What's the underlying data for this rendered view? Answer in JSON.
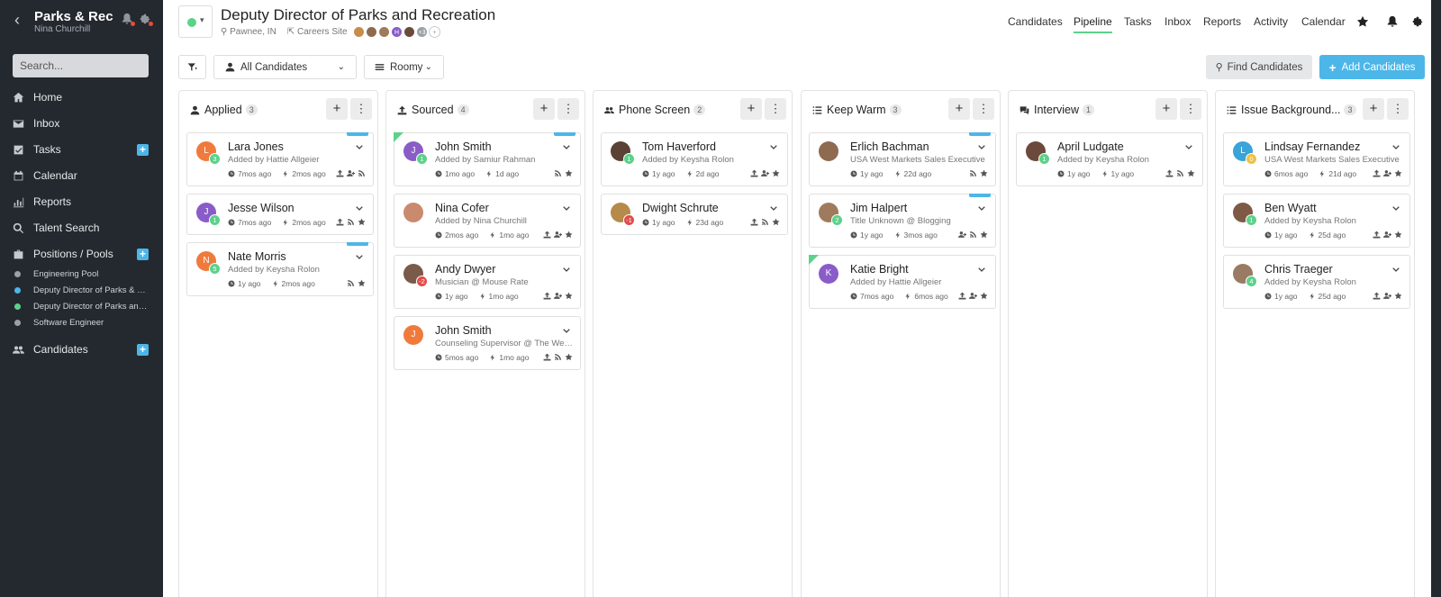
{
  "sidebar": {
    "org": "Parks & Rec",
    "user": "Nina Churchill",
    "search_placeholder": "Search...",
    "nav": [
      {
        "label": "Home",
        "icon": "home-icon"
      },
      {
        "label": "Inbox",
        "icon": "envelope-icon"
      },
      {
        "label": "Tasks",
        "icon": "checkbox-icon",
        "plus": "+"
      },
      {
        "label": "Calendar",
        "icon": "calendar-icon"
      },
      {
        "label": "Reports",
        "icon": "bar-chart-icon"
      },
      {
        "label": "Talent Search",
        "icon": "search-icon"
      },
      {
        "label": "Positions / Pools",
        "icon": "briefcase-icon",
        "plus": "+"
      }
    ],
    "pools": [
      {
        "label": "Engineering Pool",
        "color": "#9aa0a6"
      },
      {
        "label": "Deputy Director of Parks & Recreation",
        "color": "#4db6e8"
      },
      {
        "label": "Deputy Director of Parks and Recreation",
        "color": "#5bd28a"
      },
      {
        "label": "Software Engineer",
        "color": "#9aa0a6"
      }
    ],
    "candidates": {
      "label": "Candidates",
      "plus": "+"
    }
  },
  "header": {
    "title": "Deputy Director of Parks and Recreation",
    "location": "Pawnee, IN",
    "careers": "Careers Site",
    "extra_count": "+3",
    "status_color": "#5bd28a",
    "tabs": [
      "Candidates",
      "Pipeline",
      "Tasks",
      "Inbox",
      "Reports",
      "Activity",
      "Calendar"
    ],
    "active_tab": "Pipeline"
  },
  "toolbar": {
    "filter_select": "All Candidates",
    "view_select": "Roomy",
    "find_label": "Find Candidates",
    "add_label": "Add Candidates"
  },
  "columns": [
    {
      "title": "Applied",
      "count": "3",
      "icon": "user-icon",
      "cards": [
        {
          "name": "Lara Jones",
          "sub": "Added by Hattie Allgeier",
          "t1": "7mos ago",
          "t2": "2mos ago",
          "initial": "L",
          "avatar_color": "#f07a3c",
          "badge": "3",
          "badge_color": "#5bd28a",
          "ribbon": true,
          "corner": false
        },
        {
          "name": "Jesse Wilson",
          "sub": "",
          "t1": "7mos ago",
          "t2": "2mos ago",
          "initial": "J",
          "avatar_color": "#8a5cc8",
          "badge": "1",
          "badge_color": "#5bd28a",
          "ribbon": false,
          "corner": false
        },
        {
          "name": "Nate Morris",
          "sub": "Added by Keysha Rolon",
          "t1": "1y ago",
          "t2": "2mos ago",
          "initial": "N",
          "avatar_color": "#f07a3c",
          "badge": "5",
          "badge_color": "#5bd28a",
          "ribbon": true,
          "corner": false
        }
      ]
    },
    {
      "title": "Sourced",
      "count": "4",
      "icon": "upload-icon",
      "cards": [
        {
          "name": "John Smith",
          "sub": "Added by Samiur Rahman",
          "t1": "1mo ago",
          "t2": "1d ago",
          "initial": "J",
          "avatar_color": "#8a5cc8",
          "badge": "1",
          "badge_color": "#5bd28a",
          "ribbon": true,
          "corner": true
        },
        {
          "name": "Nina Cofer",
          "sub": "Added by Nina Churchill",
          "t1": "2mos ago",
          "t2": "1mo ago",
          "initial": "",
          "avatar_color": "#c98a6e",
          "badge": "",
          "badge_color": "",
          "ribbon": false,
          "corner": false
        },
        {
          "name": "Andy Dwyer",
          "sub": "Musician @ Mouse Rate",
          "t1": "1y ago",
          "t2": "1mo ago",
          "initial": "",
          "avatar_color": "#7a5a48",
          "badge": "-2",
          "badge_color": "#e24b4b",
          "ribbon": false,
          "corner": false
        },
        {
          "name": "John Smith",
          "sub": "Counseling Supervisor @ The Wellness Center",
          "t1": "5mos ago",
          "t2": "1mo ago",
          "initial": "J",
          "avatar_color": "#f07a3c",
          "badge": "",
          "badge_color": "",
          "ribbon": false,
          "corner": false
        }
      ]
    },
    {
      "title": "Phone Screen",
      "count": "2",
      "icon": "users-icon",
      "cards": [
        {
          "name": "Tom Haverford",
          "sub": "Added by Keysha Rolon",
          "t1": "1y ago",
          "t2": "2d ago",
          "initial": "",
          "avatar_color": "#5b4236",
          "badge": "1",
          "badge_color": "#5bd28a",
          "ribbon": false,
          "corner": false
        },
        {
          "name": "Dwight Schrute",
          "sub": "",
          "t1": "1y ago",
          "t2": "23d ago",
          "initial": "",
          "avatar_color": "#b58a4a",
          "badge": "-1",
          "badge_color": "#e24b4b",
          "ribbon": false,
          "corner": false
        }
      ]
    },
    {
      "title": "Keep Warm",
      "count": "3",
      "icon": "list-icon",
      "cards": [
        {
          "name": "Erlich Bachman",
          "sub": "USA West Markets Sales Executive",
          "t1": "1y ago",
          "t2": "22d ago",
          "initial": "",
          "avatar_color": "#8e6a4f",
          "badge": "",
          "badge_color": "",
          "ribbon": true,
          "corner": false
        },
        {
          "name": "Jim Halpert",
          "sub": "Title Unknown @ Blogging",
          "t1": "1y ago",
          "t2": "3mos ago",
          "initial": "",
          "avatar_color": "#a07a5c",
          "badge": "2",
          "badge_color": "#5bd28a",
          "ribbon": true,
          "corner": false
        },
        {
          "name": "Katie Bright",
          "sub": "Added by Hattie Allgeier",
          "t1": "7mos ago",
          "t2": "6mos ago",
          "initial": "K",
          "avatar_color": "#8a5cc8",
          "badge": "",
          "badge_color": "",
          "ribbon": false,
          "corner": true
        }
      ]
    },
    {
      "title": "Interview",
      "count": "1",
      "icon": "comments-icon",
      "cards": [
        {
          "name": "April Ludgate",
          "sub": "Added by Keysha Rolon",
          "t1": "1y ago",
          "t2": "1y ago",
          "initial": "",
          "avatar_color": "#6b4a3c",
          "badge": "1",
          "badge_color": "#5bd28a",
          "ribbon": false,
          "corner": false
        }
      ]
    },
    {
      "title": "Issue Background...",
      "count": "3",
      "icon": "list-icon",
      "cards": [
        {
          "name": "Lindsay Fernandez",
          "sub": "USA West Markets Sales Executive",
          "t1": "6mos ago",
          "t2": "21d ago",
          "initial": "L",
          "avatar_color": "#3aa3d8",
          "badge": "0",
          "badge_color": "#f0c040",
          "ribbon": false,
          "corner": false
        },
        {
          "name": "Ben Wyatt",
          "sub": "Added by Keysha Rolon",
          "t1": "1y ago",
          "t2": "25d ago",
          "initial": "",
          "avatar_color": "#7e5a44",
          "badge": "1",
          "badge_color": "#5bd28a",
          "ribbon": false,
          "corner": false
        },
        {
          "name": "Chris Traeger",
          "sub": "Added by Keysha Rolon",
          "t1": "1y ago",
          "t2": "25d ago",
          "initial": "",
          "avatar_color": "#9a7a62",
          "badge": "4",
          "badge_color": "#5bd28a",
          "ribbon": false,
          "corner": false
        }
      ]
    }
  ]
}
